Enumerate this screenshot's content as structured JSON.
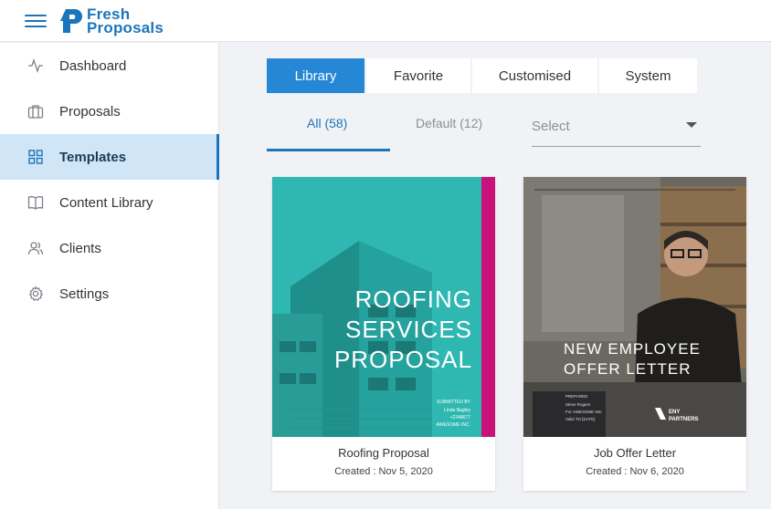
{
  "brand": {
    "line1": "Fresh",
    "line2": "Proposals",
    "color": "#1b75bb"
  },
  "sidebar": {
    "items": [
      {
        "label": "Dashboard",
        "icon": "activity-icon"
      },
      {
        "label": "Proposals",
        "icon": "briefcase-icon"
      },
      {
        "label": "Templates",
        "icon": "grid-icon",
        "active": true
      },
      {
        "label": "Content Library",
        "icon": "book-icon"
      },
      {
        "label": "Clients",
        "icon": "users-icon"
      },
      {
        "label": "Settings",
        "icon": "gear-icon"
      }
    ]
  },
  "segments": [
    "Library",
    "Favorite",
    "Customised",
    "System"
  ],
  "tabs": [
    "All (58)",
    "Default (12)"
  ],
  "select": {
    "placeholder": "Select"
  },
  "templates": [
    {
      "name": "Roofing Proposal",
      "created": "Created : Nov 5, 2020",
      "cover_lines": [
        "ROOFING",
        "SERVICES",
        "PROPOSAL"
      ],
      "submitted": [
        "SUBMITTED BY",
        "Linda Bagley",
        "+2348677",
        "AWESOME INC."
      ],
      "colors": {
        "teal": "#2fb8b2",
        "accent": "#c8127a"
      }
    },
    {
      "name": "Job Offer Letter",
      "created": "Created : Nov 6, 2020",
      "cover_lines": [
        "NEW EMPLOYEE",
        "OFFER LETTER"
      ],
      "submitted": [
        "PREPARED",
        "Steve Rogers",
        "For AWESOME INC",
        "Valid TO [DATE]"
      ],
      "badge": [
        "ENY",
        "PARTNERS"
      ]
    }
  ]
}
